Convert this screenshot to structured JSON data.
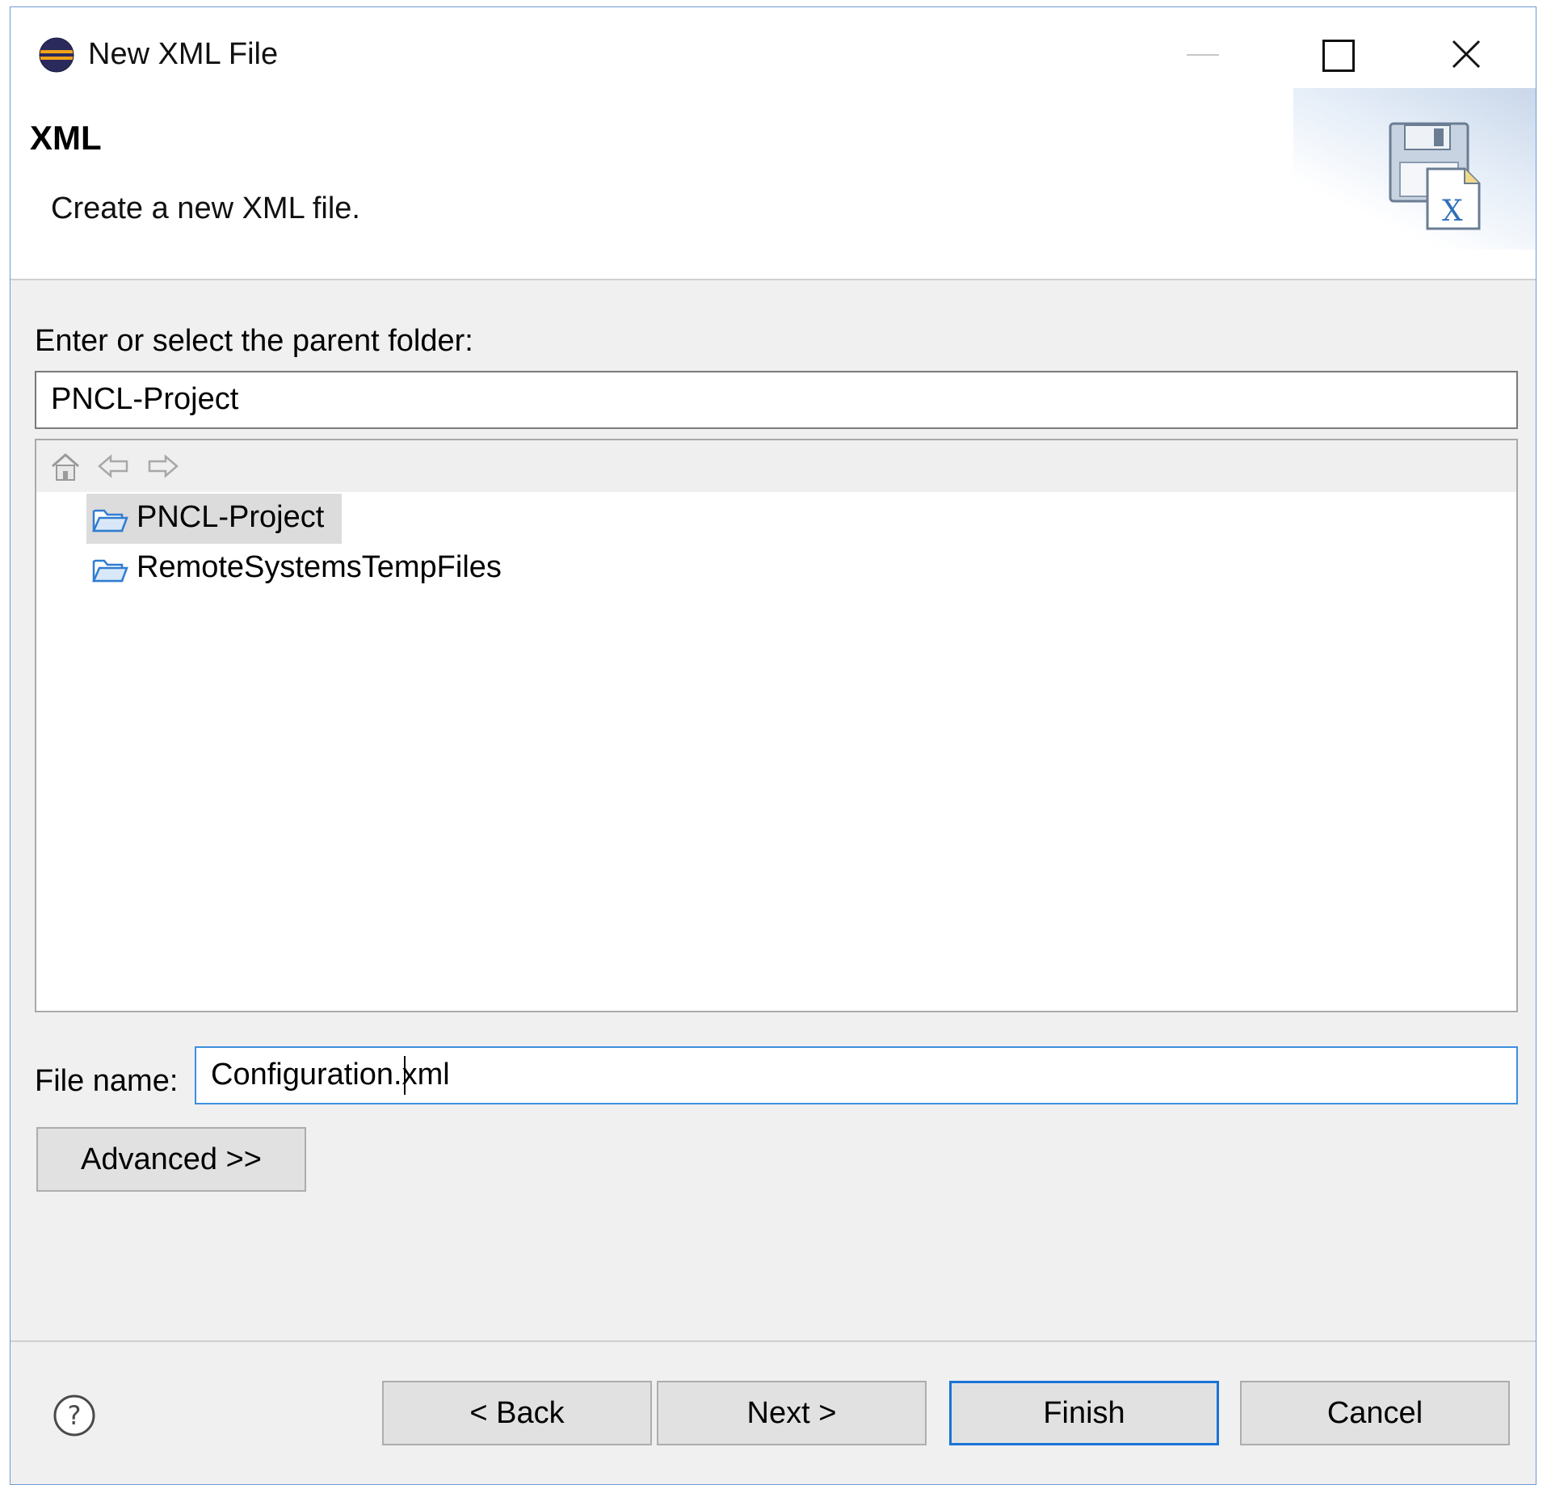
{
  "window": {
    "title": "New XML File"
  },
  "header": {
    "title": "XML",
    "description": "Create a new XML file."
  },
  "parent_folder": {
    "label": "Enter or select the parent folder:",
    "value": "PNCL-Project"
  },
  "tree": {
    "items": [
      {
        "label": "PNCL-Project",
        "selected": true
      },
      {
        "label": "RemoteSystemsTempFiles",
        "selected": false
      }
    ]
  },
  "file_name": {
    "label": "File name:",
    "value": "Configuration.xml"
  },
  "buttons": {
    "advanced": "Advanced >>",
    "back": "< Back",
    "next": "Next >",
    "finish": "Finish",
    "cancel": "Cancel"
  },
  "colors": {
    "accent": "#1a73d6",
    "folder_icon": "#2f7cd1",
    "selection": "#dcdcdc"
  },
  "icons": [
    "eclipse-app-icon",
    "minimize-icon",
    "maximize-icon",
    "close-icon",
    "xml-wizard-icon",
    "home-icon",
    "back-arrow-icon",
    "forward-arrow-icon",
    "folder-icon",
    "help-icon"
  ]
}
